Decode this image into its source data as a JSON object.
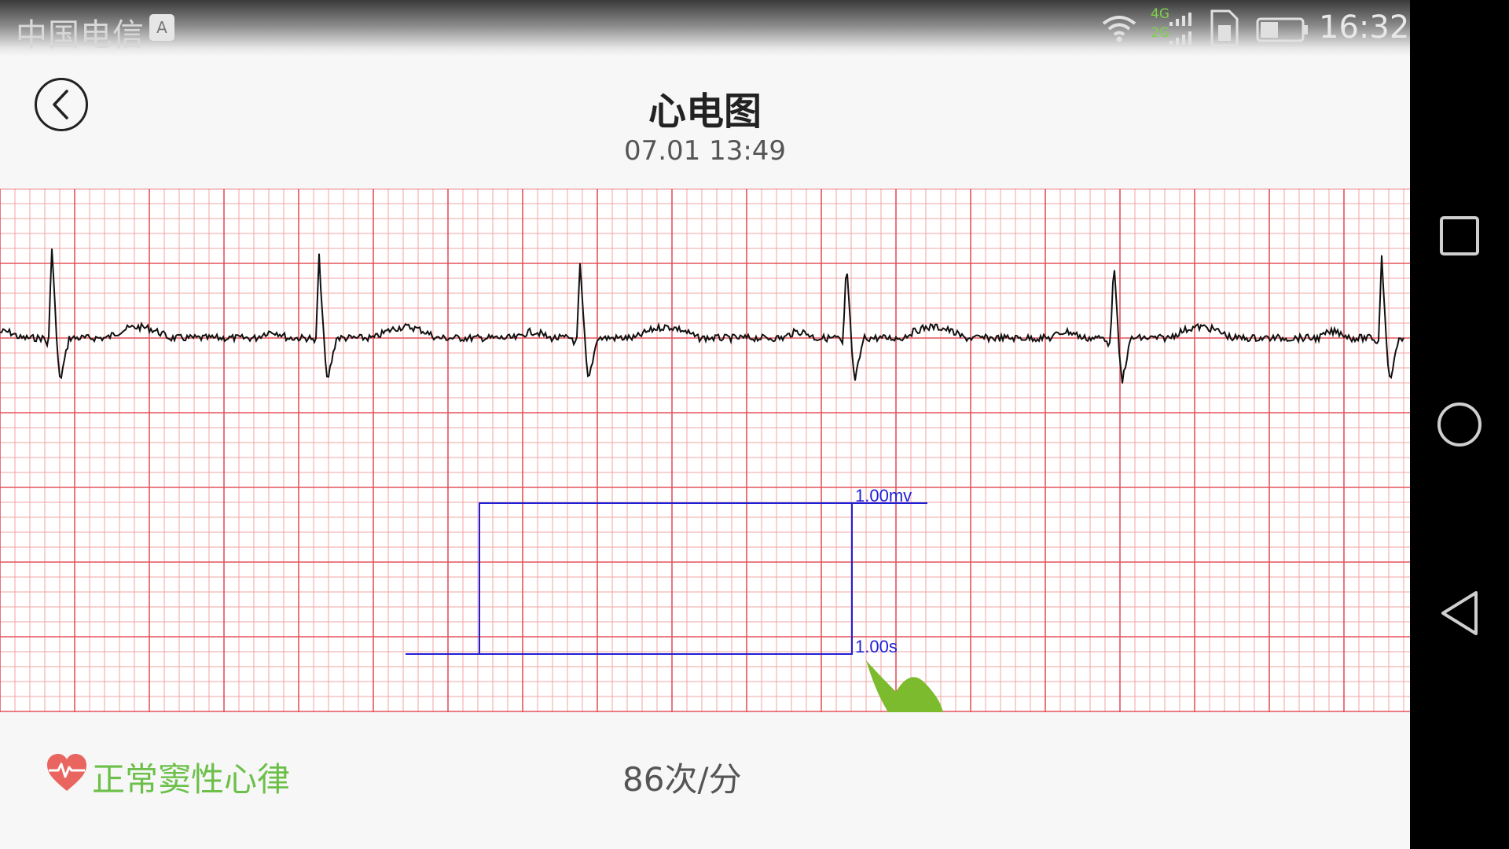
{
  "status_bar": {
    "carrier": "中国电信",
    "keyboard_badge": "A",
    "network_4g": "4G",
    "network_2g": "2G",
    "time": "16:32"
  },
  "header": {
    "title": "心电图",
    "subtitle": "07.01 13:49"
  },
  "ecg": {
    "calibration_voltage_label": "1.00mv",
    "calibration_time_label": "1.00s",
    "colors": {
      "grid_minor": "#f2a3a3",
      "grid_major": "#e4545b",
      "trace": "#111111",
      "calibration": "#1f1fd6",
      "pointer": "#7dbb2e"
    }
  },
  "footer": {
    "rhythm": "正常窦性心律",
    "heart_rate": "86次/分",
    "rhythm_color": "#6cc04a"
  },
  "icons": {
    "back": "back-circle-icon",
    "heart": "heart-ecg-icon",
    "wifi": "wifi-icon",
    "signal": "signal-icon",
    "sim": "sim-card-icon",
    "battery": "battery-icon",
    "recents": "recents-square-icon",
    "home": "home-circle-icon",
    "nav_back": "back-triangle-icon",
    "hand": "pointer-hand-icon"
  }
}
